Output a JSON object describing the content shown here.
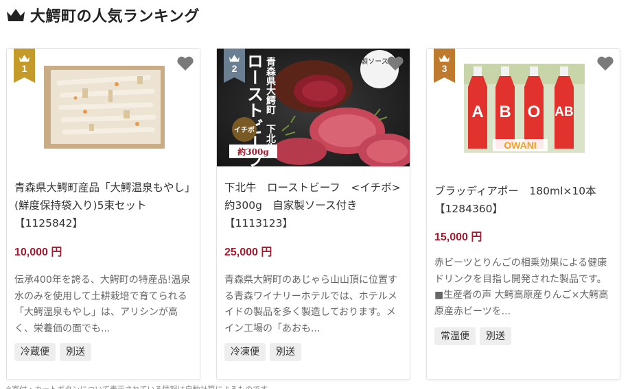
{
  "heading": {
    "icon": "crown-icon",
    "title": "大鰐町の人気ランキング"
  },
  "colors": {
    "price": "#a6192e",
    "rank_gold": "#c49a2a",
    "rank_silver": "#6b7f92",
    "rank_bronze": "#bf7a2e",
    "heart": "#7a7a7a",
    "tag_bg": "#eeeeee"
  },
  "cards": [
    {
      "rank": "1",
      "title": "青森県大鰐町産品「大鰐温泉もやし」(鮮度保持袋入り)5束セット【1125842】",
      "price": "10,000 円",
      "description": "伝承400年を誇る、大鰐町の特産品!温泉水のみを使用して土耕栽培で育てられる「大鰐温泉もやし」は、アリシンが高く、栄養価の面でも...",
      "tags": [
        "冷蔵便",
        "別送"
      ]
    },
    {
      "rank": "2",
      "image_text": {
        "vertical_1": "青森県大鰐町　下北牛",
        "vertical_2": "ローストビーフ",
        "badge_cut": "イチボ",
        "badge_weight": "約300g",
        "badge_sauce": "自家製ソース付き"
      },
      "title": "下北牛　ローストビーフ　<イチボ>　約300g　自家製ソース付き【1113123】",
      "price": "25,000 円",
      "description": "青森県大鰐町のあじゃら山山頂に位置する青森ワイナリーホテルでは、ホテルメイドの製品を多く製造しております。メイン工場の「あおも...",
      "tags": [
        "冷凍便",
        "別送"
      ]
    },
    {
      "rank": "3",
      "image_text": {
        "letter_a": "A",
        "letter_b": "B",
        "letter_o": "O",
        "letter_ab": "AB",
        "brand": "OWANI"
      },
      "title": "ブラッディアポー　180ml×10本【1284360】",
      "price": "15,000 円",
      "description": "赤ビーツとりんごの相乗効果による健康ドリンクを目指し開発された製品です。■生産者の声 大鰐高原産りんご×大鰐高原産赤ビーツを...",
      "tags": [
        "常温便",
        "別送"
      ]
    }
  ],
  "footer_note": "※寄付・カートボタンについて表示されている情報は自動計算によるものです"
}
